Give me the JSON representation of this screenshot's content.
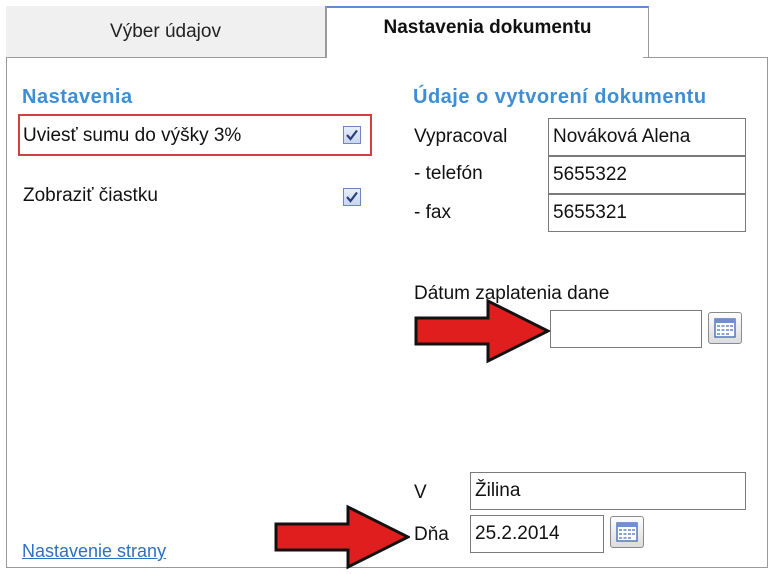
{
  "tabs": [
    {
      "label": "Výber údajov",
      "active": false
    },
    {
      "label": "Nastavenia dokumentu",
      "active": true
    }
  ],
  "settings": {
    "heading": "Nastavenia",
    "options": [
      {
        "label": "Uviesť sumu do výšky 3%",
        "checked": true,
        "highlighted": true
      },
      {
        "label": "Zobraziť čiastku",
        "checked": true,
        "highlighted": false
      }
    ],
    "page_setup_link": "Nastavenie strany"
  },
  "document_info": {
    "heading": "Údaje o vytvorení dokumentu",
    "prepared_by_label": "Vypracoval",
    "prepared_by_value": "Nováková Alena",
    "phone_label": "- telefón",
    "phone_value": "5655322",
    "fax_label": "- fax",
    "fax_value": "5655321",
    "tax_payment_date_label": "Dátum zaplatenia dane",
    "tax_payment_date_value": "",
    "place_label": "V",
    "place_value": "Žilina",
    "date_label": "Dňa",
    "date_value": "25.2.2014"
  },
  "icons": {
    "calendar": "calendar-icon",
    "checkmark": "checkmark-icon",
    "arrow": "arrow-right-icon"
  },
  "colors": {
    "heading": "#3e8ed6",
    "highlight_border": "#d04040",
    "arrow_fill": "#e01e1e",
    "link": "#2e6fc2"
  }
}
